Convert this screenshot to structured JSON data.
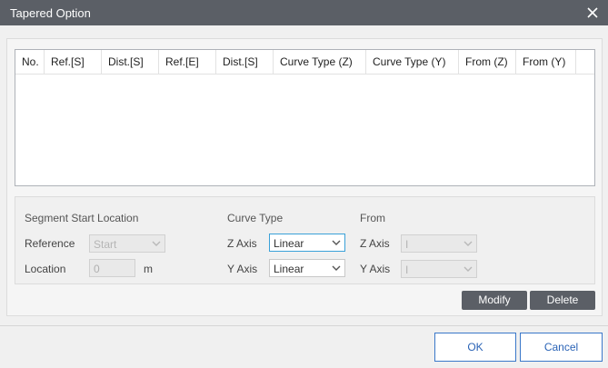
{
  "window": {
    "title": "Tapered Option"
  },
  "table": {
    "columns": [
      "No.",
      "Ref.[S]",
      "Dist.[S]",
      "Ref.[E]",
      "Dist.[S]",
      "Curve Type (Z)",
      "Curve Type (Y)",
      "From (Z)",
      "From (Y)"
    ]
  },
  "segment": {
    "header": "Segment Start Location",
    "reference_label": "Reference",
    "reference_value": "Start",
    "location_label": "Location",
    "location_value": "0",
    "location_unit": "m"
  },
  "curve_type": {
    "header": "Curve Type",
    "z_label": "Z Axis",
    "z_value": "Linear",
    "y_label": "Y Axis",
    "y_value": "Linear"
  },
  "from": {
    "header": "From",
    "z_label": "Z Axis",
    "z_value": "I",
    "y_label": "Y Axis",
    "y_value": "I"
  },
  "actions": {
    "modify": "Modify",
    "delete": "Delete"
  },
  "footer": {
    "ok": "OK",
    "cancel": "Cancel"
  }
}
